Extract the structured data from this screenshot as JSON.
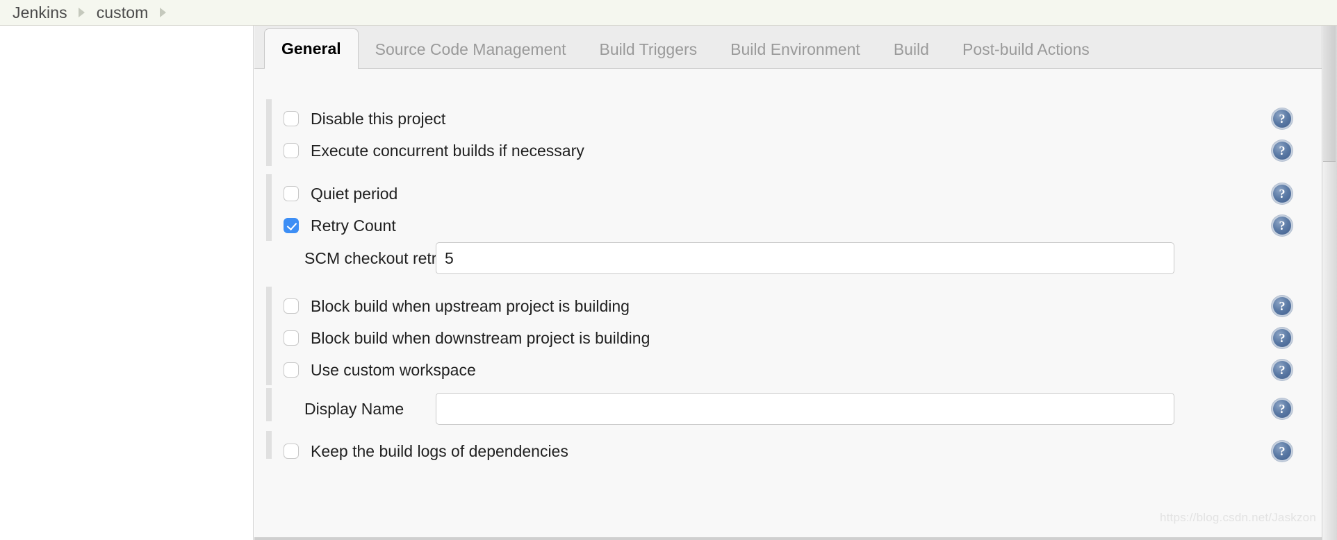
{
  "breadcrumb": {
    "items": [
      {
        "label": "Jenkins"
      },
      {
        "label": "custom"
      }
    ],
    "separator_icon": "chevron-right-icon"
  },
  "tabs": [
    {
      "label": "General",
      "active": true
    },
    {
      "label": "Source Code Management",
      "active": false
    },
    {
      "label": "Build Triggers",
      "active": false
    },
    {
      "label": "Build Environment",
      "active": false
    },
    {
      "label": "Build",
      "active": false
    },
    {
      "label": "Post-build Actions",
      "active": false
    }
  ],
  "help_icon_name": "help-question-icon",
  "colors": {
    "checkbox_checked": "#3d8ef5",
    "breadcrumb_bg": "#f5f7ef",
    "panel_bg": "#f8f8f8",
    "tabbar_bg": "#ececec",
    "help_icon": "#4a6ea0"
  },
  "rows": [
    {
      "kind": "checkbox",
      "name": "disable-this-project",
      "label": "Disable this project",
      "checked": false,
      "help": true
    },
    {
      "kind": "checkbox",
      "name": "execute-concurrent-builds",
      "label": "Execute concurrent builds if necessary",
      "checked": false,
      "help": true
    },
    {
      "kind": "checkbox",
      "name": "quiet-period",
      "label": "Quiet period",
      "checked": false,
      "help": true
    },
    {
      "kind": "checkbox",
      "name": "retry-count",
      "label": "Retry Count",
      "checked": true,
      "help": true
    },
    {
      "kind": "field",
      "name": "scm-checkout-retry-count",
      "label": "SCM checkout retry count",
      "value": "5",
      "placeholder": "",
      "help": false
    },
    {
      "kind": "checkbox",
      "name": "block-build-upstream",
      "label": "Block build when upstream project is building",
      "checked": false,
      "help": true
    },
    {
      "kind": "checkbox",
      "name": "block-build-downstream",
      "label": "Block build when downstream project is building",
      "checked": false,
      "help": true
    },
    {
      "kind": "checkbox",
      "name": "use-custom-workspace",
      "label": "Use custom workspace",
      "checked": false,
      "help": true
    },
    {
      "kind": "field",
      "name": "display-name",
      "label": "Display Name",
      "value": "",
      "placeholder": "",
      "help": true
    },
    {
      "kind": "checkbox",
      "name": "keep-build-logs-dependencies",
      "label": "Keep the build logs of dependencies",
      "checked": false,
      "help": true
    }
  ],
  "watermark": "https://blog.csdn.net/Jaskzon"
}
